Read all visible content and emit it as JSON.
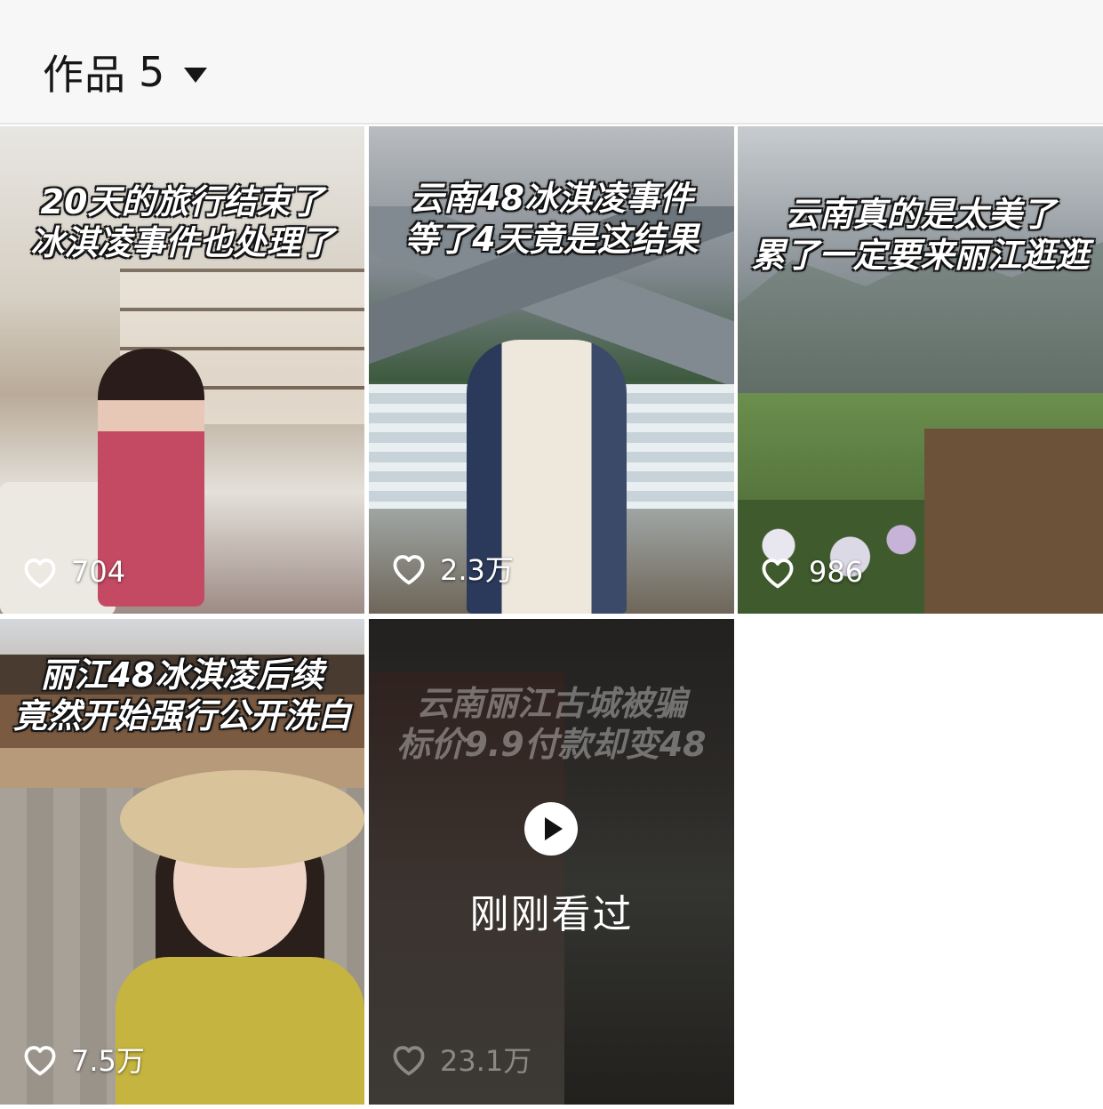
{
  "header": {
    "works_label": "作品",
    "works_count": "5"
  },
  "videos": [
    {
      "caption_line1": "20天的旅行结束了",
      "caption_line2": "冰淇凌事件也处理了",
      "likes": "704"
    },
    {
      "caption_line1": "云南48冰淇凌事件",
      "caption_line2": "等了4天竟是这结果",
      "likes": "2.3万"
    },
    {
      "caption_line1": "云南真的是太美了",
      "caption_line2": "累了一定要来丽江逛逛",
      "likes": "986"
    },
    {
      "caption_line1": "丽江48冰淇凌后续",
      "caption_line2": "竟然开始强行公开洗白",
      "likes": "7.5万"
    },
    {
      "caption_line1": "云南丽江古城被骗",
      "caption_line2": "标价9.9付款却变48",
      "likes": "23.1万",
      "overlay_label": "刚刚看过"
    }
  ],
  "icons": {
    "like": "heart-outline-icon",
    "play": "play-icon",
    "dropdown": "caret-down-icon"
  }
}
